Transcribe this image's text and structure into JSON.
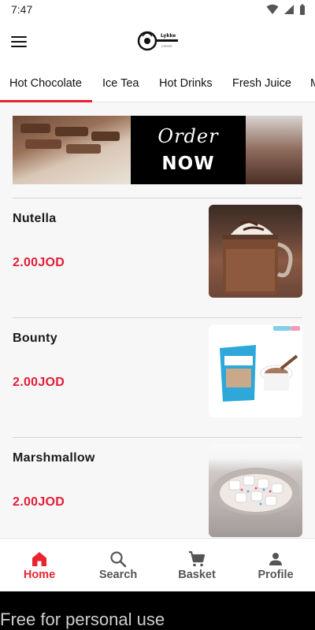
{
  "status_bar": {
    "time": "7:47"
  },
  "app_bar": {
    "logo_text": "Lykke"
  },
  "tabs": [
    {
      "label": "Hot Chocolate",
      "active": true
    },
    {
      "label": "Ice Tea"
    },
    {
      "label": "Hot Drinks"
    },
    {
      "label": "Fresh Juice"
    },
    {
      "label": "M"
    }
  ],
  "banner": {
    "line1": "Order",
    "line2": "NOW"
  },
  "products": [
    {
      "name": "Nutella",
      "price": "2.00JOD"
    },
    {
      "name": "Bounty",
      "price": "2.00JOD"
    },
    {
      "name": "Marshmallow",
      "price": "2.00JOD"
    }
  ],
  "bottom_nav": [
    {
      "label": "Home",
      "icon": "home-icon",
      "active": true
    },
    {
      "label": "Search",
      "icon": "search-icon"
    },
    {
      "label": "Basket",
      "icon": "cart-icon"
    },
    {
      "label": "Profile",
      "icon": "person-icon"
    }
  ],
  "watermark": "Free for personal use",
  "colors": {
    "accent": "#e8242f",
    "price": "#e41c38"
  }
}
